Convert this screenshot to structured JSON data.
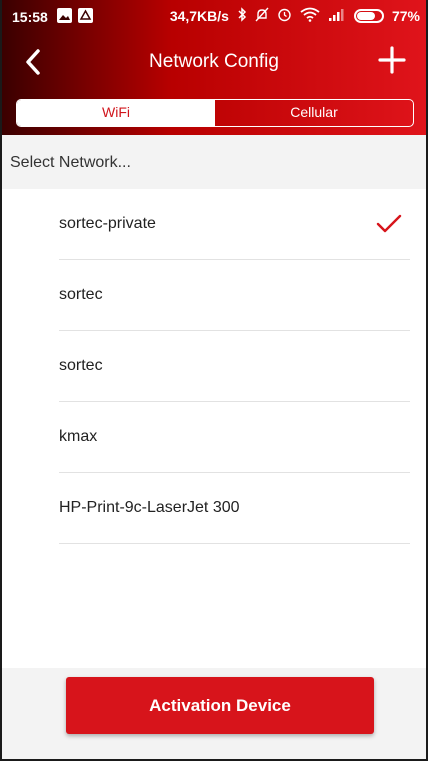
{
  "status_bar": {
    "time": "15:58",
    "net_speed": "34,7KB/s",
    "battery_percent": "77%",
    "battery_level": 0.77,
    "icons": [
      "image-notification-icon",
      "alert-notification-icon",
      "bluetooth-icon",
      "mute-icon",
      "alarm-icon",
      "wifi-icon",
      "signal-icon",
      "battery-icon"
    ]
  },
  "nav": {
    "title": "Network Config",
    "back_icon": "chevron-left-icon",
    "add_icon": "plus-icon"
  },
  "tabs": [
    {
      "label": "WiFi",
      "active": true
    },
    {
      "label": "Cellular",
      "active": false
    }
  ],
  "section": {
    "title": "Select Network..."
  },
  "networks": [
    {
      "name": "sortec-private",
      "selected": true
    },
    {
      "name": "sortec",
      "selected": false
    },
    {
      "name": "sortec",
      "selected": false
    },
    {
      "name": "kmax",
      "selected": false
    },
    {
      "name": "HP-Print-9c-LaserJet 300",
      "selected": false
    }
  ],
  "actions": {
    "activation_label": "Activation Device"
  },
  "colors": {
    "accent": "#d7141b",
    "header_dark": "#3a0000",
    "header_light": "#e0141b",
    "section_bg": "#f3f3f3"
  }
}
